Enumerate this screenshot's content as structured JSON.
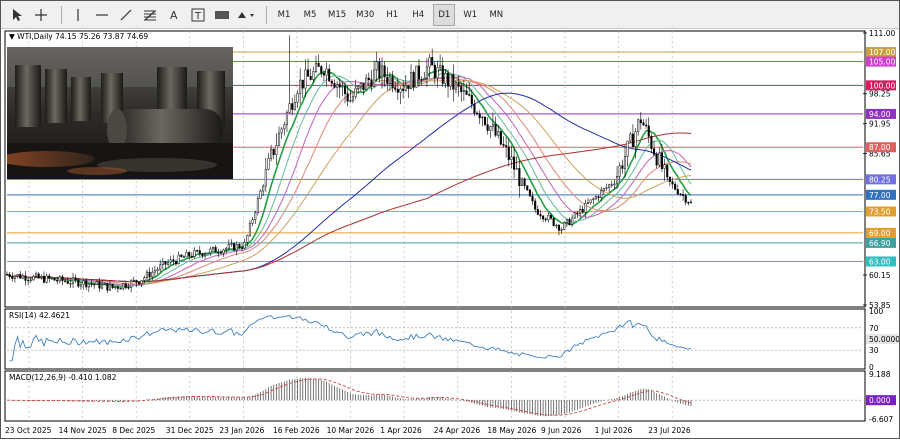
{
  "toolbar": {
    "timeframes": [
      "M1",
      "M5",
      "M15",
      "M30",
      "H1",
      "H4",
      "D1",
      "W1",
      "MN"
    ],
    "active_timeframe": "D1"
  },
  "chart": {
    "legend": "WTI,Daily  74.15 75.26 73.87 74.69",
    "price_axis": [
      "111.00",
      "98.25",
      "91.95",
      "85.65",
      "60.15",
      "53.85"
    ],
    "levels": [
      {
        "label": "107.00",
        "value": 107.0,
        "color": "#c8a040"
      },
      {
        "label": "105.00",
        "value": 105.0,
        "color": "#d040d0"
      },
      {
        "label": "100.00",
        "value": 100.0,
        "color": "#d02060"
      },
      {
        "label": "94.00",
        "value": 94.0,
        "color": "#9030c0"
      },
      {
        "label": "87.00",
        "value": 87.0,
        "color": "#e06060"
      },
      {
        "label": "80.25",
        "value": 80.25,
        "color": "#7070e0"
      },
      {
        "label": "77.00",
        "value": 77.0,
        "color": "#3070c0"
      },
      {
        "label": "73.50",
        "value": 73.5,
        "color": "#e0a030"
      },
      {
        "label": "69.00",
        "value": 69.0,
        "color": "#e0a030"
      },
      {
        "label": "66.90",
        "value": 66.9,
        "color": "#40a0a0"
      },
      {
        "label": "63.00",
        "value": 63.0,
        "color": "#30c0c0"
      }
    ],
    "dates": [
      "23 Oct 2025",
      "14 Nov 2025",
      "8 Dec 2025",
      "31 Dec 2025",
      "23 Jan 2026",
      "16 Feb 2026",
      "10 Mar 2026",
      "1 Apr 2026",
      "24 Apr 2026",
      "18 May 2026",
      "9 Jun 2026",
      "1 Jul 2026",
      "23 Jul 2026"
    ]
  },
  "rsi": {
    "title": "RSI(14) 42.4621",
    "axis": [
      "100",
      "70",
      "50.0000",
      "30",
      "0"
    ]
  },
  "macd": {
    "title": "MACD(12,26,9) -0.410 1.082",
    "axis": [
      "9.188",
      "0.000",
      "-6.607"
    ]
  },
  "chart_data": {
    "type": "line",
    "title": "WTI,Daily",
    "x": [
      0,
      10,
      20,
      30,
      40,
      50,
      60,
      70,
      80,
      90,
      100,
      110,
      120,
      130,
      140,
      150,
      160,
      170,
      180,
      190,
      200,
      210,
      220,
      230,
      240,
      250,
      260
    ],
    "series": [
      {
        "name": "WTI",
        "values": [
          60.3,
          59.6,
          59.0,
          58.5,
          57.5,
          59.0,
          62.5,
          64.5,
          65.5,
          66.5,
          85.0,
          100.0,
          104.0,
          97.0,
          103.0,
          100.0,
          104.0,
          99.5,
          94.0,
          85.0,
          74.0,
          70.0,
          75.0,
          80.0,
          93.0,
          80.0,
          74.7
        ]
      }
    ],
    "ylim": [
      53.85,
      111.0
    ]
  },
  "colors": {
    "bull": "#000000",
    "ma_fast": "#20a040",
    "ma_mid": "#e09080",
    "ma_slow": "#d0a060",
    "ma_long": "#2030a0",
    "ma_200": "#b03030",
    "rsi": "#4080c0",
    "macd_signal": "#d04040"
  }
}
